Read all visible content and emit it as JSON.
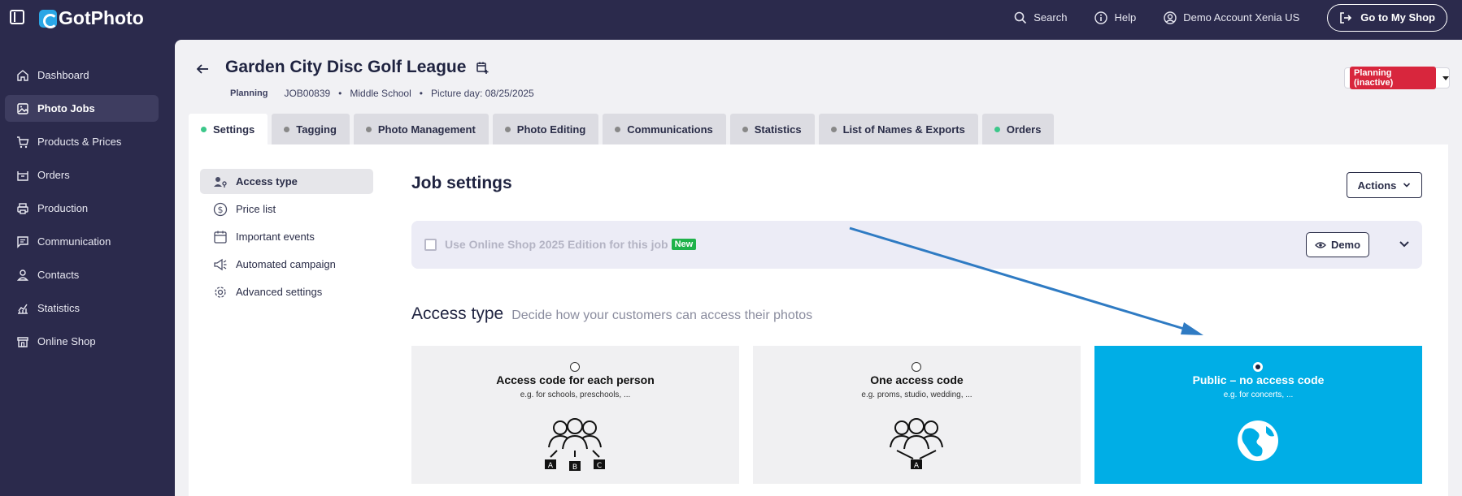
{
  "header": {
    "logo": "GotPhoto",
    "search_label": "Search",
    "help_label": "Help",
    "account_label": "Demo Account Xenia US",
    "shop_button": "Go to My Shop"
  },
  "sidebar": {
    "items": [
      {
        "label": "Dashboard",
        "icon": "home-icon"
      },
      {
        "label": "Photo Jobs",
        "icon": "image-icon"
      },
      {
        "label": "Products & Prices",
        "icon": "cart-icon"
      },
      {
        "label": "Orders",
        "icon": "box-icon"
      },
      {
        "label": "Production",
        "icon": "printer-icon"
      },
      {
        "label": "Communication",
        "icon": "message-icon"
      },
      {
        "label": "Contacts",
        "icon": "person-icon"
      },
      {
        "label": "Statistics",
        "icon": "chart-icon"
      },
      {
        "label": "Online Shop",
        "icon": "store-icon"
      }
    ]
  },
  "job": {
    "title": "Garden City Disc Golf League",
    "status_label": "Planning",
    "job_id": "JOB00839",
    "school_type": "Middle School",
    "picture_day": "Picture day: 08/25/2025",
    "status_badge": "Planning (inactive)"
  },
  "tabs": [
    {
      "label": "Settings",
      "dot": "green"
    },
    {
      "label": "Tagging",
      "dot": "gray"
    },
    {
      "label": "Photo Management",
      "dot": "gray"
    },
    {
      "label": "Photo Editing",
      "dot": "gray"
    },
    {
      "label": "Communications",
      "dot": "gray"
    },
    {
      "label": "Statistics",
      "dot": "gray"
    },
    {
      "label": "List of Names & Exports",
      "dot": "gray"
    },
    {
      "label": "Orders",
      "dot": "green"
    }
  ],
  "subnav": [
    {
      "label": "Access type",
      "icon": "user-key-icon"
    },
    {
      "label": "Price list",
      "icon": "dollar-icon"
    },
    {
      "label": "Important events",
      "icon": "calendar-icon"
    },
    {
      "label": "Automated campaign",
      "icon": "megaphone-icon"
    },
    {
      "label": "Advanced settings",
      "icon": "gear-icon"
    }
  ],
  "settings": {
    "title": "Job settings",
    "actions_label": "Actions",
    "shop_edition_label": "Use Online Shop 2025 Edition for this job",
    "new_badge": "New",
    "demo_label": "Demo",
    "access_heading": "Access type",
    "access_sub": "Decide how your customers can access their photos"
  },
  "access_cards": [
    {
      "title": "Access code for each person",
      "sub": "e.g. for schools, preschools, ...",
      "selected": false
    },
    {
      "title": "One access code",
      "sub": "e.g. proms, studio, wedding, ...",
      "selected": false
    },
    {
      "title": "Public – no access code",
      "sub": "e.g. for concerts, ...",
      "selected": true
    }
  ],
  "colors": {
    "sidebar_bg": "#2b2a4c",
    "accent_selected": "#00aee6",
    "status_red": "#d8263d",
    "green_dot": "#3cc78a",
    "arrow": "#2f7bc3"
  }
}
